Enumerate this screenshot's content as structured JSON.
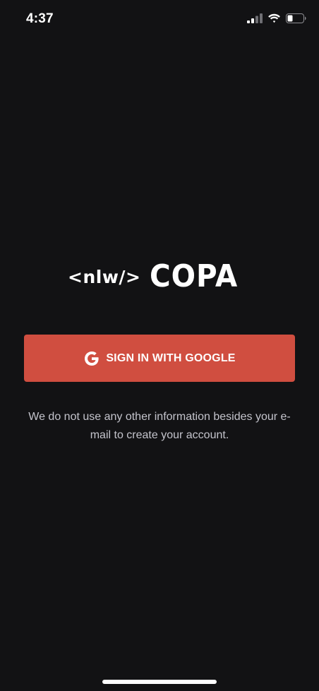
{
  "status_bar": {
    "time": "4:37"
  },
  "logo": {
    "prefix": "<nlw/>",
    "name": "COPA"
  },
  "login": {
    "button_label": "SIGN IN WITH GOOGLE",
    "info_text": "We do not use any other information besides your e-mail to create your account."
  },
  "colors": {
    "background": "#121214",
    "button": "#d04e40",
    "info_text": "#c4c4cc"
  },
  "icons": {
    "signal": "cellular-signal-icon",
    "wifi": "wifi-icon",
    "battery": "battery-icon",
    "google": "google-icon"
  }
}
